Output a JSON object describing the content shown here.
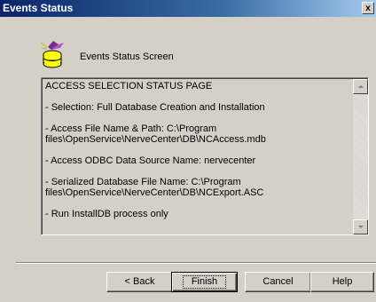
{
  "window": {
    "title": "Events Status",
    "close_glyph": "x"
  },
  "header": {
    "icon": "database-wizard-icon",
    "label": "Events Status Screen"
  },
  "status": {
    "text": "ACCESS SELECTION STATUS PAGE\n\n- Selection: Full Database Creation and Installation\n\n- Access File Name & Path: C:\\Program files\\OpenService\\NerveCenter\\DB\\NCAccess.mdb\n\n- Access ODBC Data Source Name: nervecenter\n\n- Serialized Database File Name: C:\\Program files\\OpenService\\NerveCenter\\DB\\NCExport.ASC\n\n- Run InstallDB process only"
  },
  "buttons": {
    "back": "< Back",
    "finish": "Finish",
    "cancel": "Cancel",
    "help": "Help"
  },
  "colors": {
    "face": "#d4d0c8",
    "title_start": "#0a246a",
    "title_end": "#a6caf0"
  }
}
